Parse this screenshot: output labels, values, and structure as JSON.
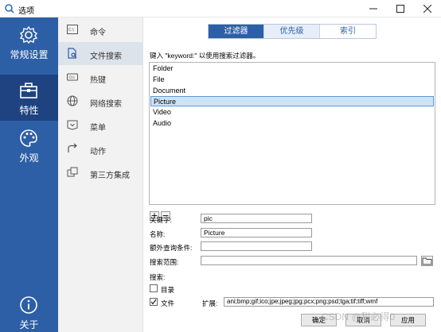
{
  "window": {
    "title": "选项",
    "controls": [
      "minimize",
      "maximize",
      "close"
    ]
  },
  "left_nav": {
    "items": [
      {
        "label": "常规设置",
        "icon": "gear-icon",
        "active": false
      },
      {
        "label": "特性",
        "icon": "toolbox-icon",
        "active": true
      },
      {
        "label": "外观",
        "icon": "palette-icon",
        "active": false
      }
    ],
    "bottom": {
      "label": "关于",
      "icon": "info-icon"
    }
  },
  "mid_nav": {
    "items": [
      {
        "label": "命令",
        "icon": "command-icon",
        "active": false
      },
      {
        "label": "文件搜索",
        "icon": "file-search-icon",
        "active": true
      },
      {
        "label": "热键",
        "icon": "keyboard-icon",
        "active": false
      },
      {
        "label": "网络搜索",
        "icon": "globe-icon",
        "active": false
      },
      {
        "label": "菜单",
        "icon": "menu-icon",
        "active": false
      },
      {
        "label": "动作",
        "icon": "action-icon",
        "active": false
      },
      {
        "label": "第三方集成",
        "icon": "integration-icon",
        "active": false
      }
    ]
  },
  "tabs": [
    {
      "label": "过滤器",
      "state": "active"
    },
    {
      "label": "优先级",
      "state": "soft"
    },
    {
      "label": "索引",
      "state": "normal"
    }
  ],
  "filters": {
    "hint": "键入 \"keyword:\" 以使用搜索过滤器。",
    "items": [
      "Folder",
      "File",
      "Document",
      "Picture",
      "Video",
      "Audio"
    ],
    "selected": "Picture",
    "add_label": "+",
    "remove_label": "−"
  },
  "form": {
    "keyword_label": "关键字:",
    "keyword_value": "pic",
    "name_label": "名称:",
    "name_value": "Picture",
    "extra_label": "额外查询条件:",
    "extra_value": "",
    "scope_label": "搜索范围:",
    "scope_value": "",
    "search_label": "搜索:",
    "dir_label": "目录",
    "dir_checked": false,
    "file_label": "文件",
    "file_checked": true,
    "ext_label": "扩展:",
    "ext_value": "ani;bmp;gif;ico;jpe;jpeg;jpg;pcx;png;psd;tga;tif;tiff;wmf"
  },
  "footer": {
    "ok_label": "确定",
    "cancel_label": "取消",
    "apply_label": "应用"
  },
  "watermark": "CSDN @甜必得0",
  "colors": {
    "nav_blue": "#2d5fa6",
    "nav_blue_active": "#1e4380",
    "mid_nav_bg": "#f2f2f2",
    "selection_bg": "#cfe3f6"
  }
}
